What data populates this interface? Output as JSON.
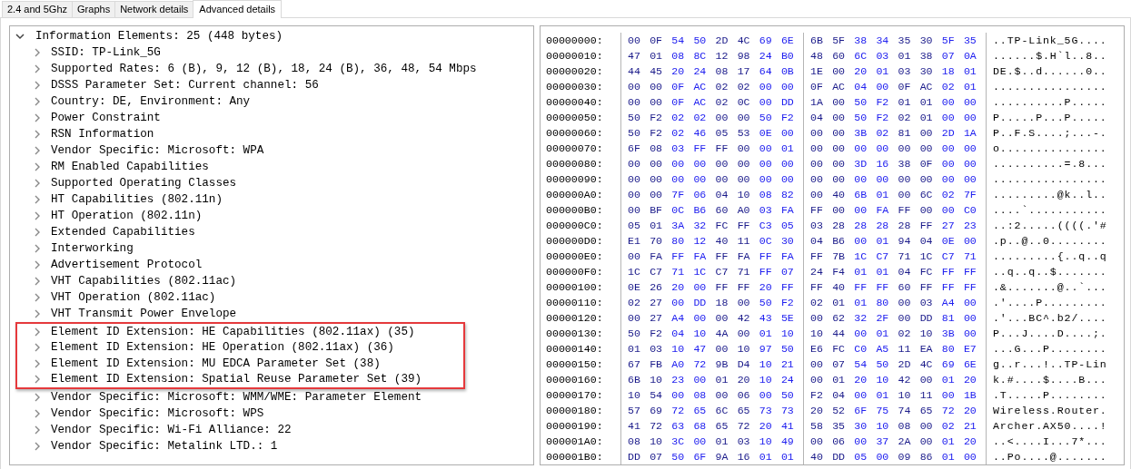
{
  "tabs": [
    {
      "label": "2.4 and 5Ghz",
      "selected": false
    },
    {
      "label": "Graphs",
      "selected": false
    },
    {
      "label": "Network details",
      "selected": false
    },
    {
      "label": "Advanced details",
      "selected": true
    }
  ],
  "tree": {
    "label": "Information Elements: 25 (448 bytes)",
    "expanded": true,
    "children": [
      {
        "label": "SSID: TP-Link_5G",
        "highlighted": false
      },
      {
        "label": "Supported Rates: 6 (B), 9, 12 (B), 18, 24 (B), 36, 48, 54 Mbps",
        "highlighted": false
      },
      {
        "label": "DSSS Parameter Set: Current channel: 56",
        "highlighted": false
      },
      {
        "label": "Country: DE, Environment: Any",
        "highlighted": false
      },
      {
        "label": "Power Constraint",
        "highlighted": false
      },
      {
        "label": "RSN Information",
        "highlighted": false
      },
      {
        "label": "Vendor Specific: Microsoft: WPA",
        "highlighted": false
      },
      {
        "label": "RM Enabled Capabilities",
        "highlighted": false
      },
      {
        "label": "Supported Operating Classes",
        "highlighted": false
      },
      {
        "label": "HT Capabilities (802.11n)",
        "highlighted": false
      },
      {
        "label": "HT Operation (802.11n)",
        "highlighted": false
      },
      {
        "label": "Extended Capabilities",
        "highlighted": false
      },
      {
        "label": "Interworking",
        "highlighted": false
      },
      {
        "label": "Advertisement Protocol",
        "highlighted": false
      },
      {
        "label": "VHT Capabilities (802.11ac)",
        "highlighted": false
      },
      {
        "label": "VHT Operation (802.11ac)",
        "highlighted": false
      },
      {
        "label": "VHT Transmit Power Envelope",
        "highlighted": false
      },
      {
        "label": "Element ID Extension: HE Capabilities (802.11ax) (35)",
        "highlighted": true
      },
      {
        "label": "Element ID Extension: HE Operation (802.11ax) (36)",
        "highlighted": true
      },
      {
        "label": "Element ID Extension: MU EDCA Parameter Set (38)",
        "highlighted": true
      },
      {
        "label": "Element ID Extension: Spatial Reuse Parameter Set (39)",
        "highlighted": true
      },
      {
        "label": "Vendor Specific: Microsoft: WMM/WME: Parameter Element",
        "highlighted": false
      },
      {
        "label": "Vendor Specific: Microsoft: WPS",
        "highlighted": false
      },
      {
        "label": "Vendor Specific: Wi-Fi Alliance: 22",
        "highlighted": false
      },
      {
        "label": "Vendor Specific: Metalink LTD.: 1",
        "highlighted": false
      }
    ]
  },
  "hex_rows": [
    {
      "offset": "00000000:",
      "bytes_1": "00 0F 54 50 2D 4C 69 6E",
      "bytes_2": "6B 5F 38 34 35 30 5F 35",
      "ascii": "..TP-Link_5G...."
    },
    {
      "offset": "00000010:",
      "bytes_1": "47 01 08 8C 12 98 24 B0",
      "bytes_2": "48 60 6C 03 01 38 07 0A",
      "ascii": "......$.H`l..8.."
    },
    {
      "offset": "00000020:",
      "bytes_1": "44 45 20 24 08 17 64 0B",
      "bytes_2": "1E 00 20 01 03 30 18 01",
      "ascii": "DE.$..d......0.."
    },
    {
      "offset": "00000030:",
      "bytes_1": "00 00 0F AC 02 02 00 00",
      "bytes_2": "0F AC 04 00 0F AC 02 01",
      "ascii": "................"
    },
    {
      "offset": "00000040:",
      "bytes_1": "00 00 0F AC 02 0C 00 DD",
      "bytes_2": "1A 00 50 F2 01 01 00 00",
      "ascii": "..........P....."
    },
    {
      "offset": "00000050:",
      "bytes_1": "50 F2 02 02 00 00 50 F2",
      "bytes_2": "04 00 50 F2 02 01 00 00",
      "ascii": "P.....P...P....."
    },
    {
      "offset": "00000060:",
      "bytes_1": "50 F2 02 46 05 53 0E 00",
      "bytes_2": "00 00 3B 02 81 00 2D 1A",
      "ascii": "P..F.S....;...-."
    },
    {
      "offset": "00000070:",
      "bytes_1": "6F 08 03 FF FF 00 00 01",
      "bytes_2": "00 00 00 00 00 00 00 00",
      "ascii": "o..............."
    },
    {
      "offset": "00000080:",
      "bytes_1": "00 00 00 00 00 00 00 00",
      "bytes_2": "00 00 3D 16 38 0F 00 00",
      "ascii": "..........=.8..."
    },
    {
      "offset": "00000090:",
      "bytes_1": "00 00 00 00 00 00 00 00",
      "bytes_2": "00 00 00 00 00 00 00 00",
      "ascii": "................"
    },
    {
      "offset": "000000A0:",
      "bytes_1": "00 00 7F 06 04 10 08 82",
      "bytes_2": "00 40 6B 01 00 6C 02 7F",
      "ascii": ".........@k..l.."
    },
    {
      "offset": "000000B0:",
      "bytes_1": "00 BF 0C B6 60 A0 03 FA",
      "bytes_2": "FF 00 00 FA FF 00 00 C0",
      "ascii": "....`..........."
    },
    {
      "offset": "000000C0:",
      "bytes_1": "05 01 3A 32 FC FF C3 05",
      "bytes_2": "03 28 28 28 28 FF 27 23",
      "ascii": "..:2.....((((.'#"
    },
    {
      "offset": "000000D0:",
      "bytes_1": "E1 70 80 12 40 11 0C 30",
      "bytes_2": "04 B6 00 01 94 04 0E 00",
      "ascii": ".p..@..0........"
    },
    {
      "offset": "000000E0:",
      "bytes_1": "00 FA FF FA FF FA FF FA",
      "bytes_2": "FF 7B 1C C7 71 1C C7 71",
      "ascii": ".........{..q..q"
    },
    {
      "offset": "000000F0:",
      "bytes_1": "1C C7 71 1C C7 71 FF 07",
      "bytes_2": "24 F4 01 01 04 FC FF FF",
      "ascii": "..q..q..$......."
    },
    {
      "offset": "00000100:",
      "bytes_1": "0E 26 20 00 FF FF 20 FF",
      "bytes_2": "FF 40 FF FF 60 FF FF FF",
      "ascii": ".&.......@..`..."
    },
    {
      "offset": "00000110:",
      "bytes_1": "02 27 00 DD 18 00 50 F2",
      "bytes_2": "02 01 01 80 00 03 A4 00",
      "ascii": ".'....P........."
    },
    {
      "offset": "00000120:",
      "bytes_1": "00 27 A4 00 00 42 43 5E",
      "bytes_2": "00 62 32 2F 00 DD 81 00",
      "ascii": ".'...BC^.b2/...."
    },
    {
      "offset": "00000130:",
      "bytes_1": "50 F2 04 10 4A 00 01 10",
      "bytes_2": "10 44 00 01 02 10 3B 00",
      "ascii": "P...J....D....;."
    },
    {
      "offset": "00000140:",
      "bytes_1": "01 03 10 47 00 10 97 50",
      "bytes_2": "E6 FC C0 A5 11 EA 80 E7",
      "ascii": "...G...P........"
    },
    {
      "offset": "00000150:",
      "bytes_1": "67 FB A0 72 9B D4 10 21",
      "bytes_2": "00 07 54 50 2D 4C 69 6E",
      "ascii": "g..r...!..TP-Lin"
    },
    {
      "offset": "00000160:",
      "bytes_1": "6B 10 23 00 01 20 10 24",
      "bytes_2": "00 01 20 10 42 00 01 20",
      "ascii": "k.#....$....B..."
    },
    {
      "offset": "00000170:",
      "bytes_1": "10 54 00 08 00 06 00 50",
      "bytes_2": "F2 04 00 01 10 11 00 1B",
      "ascii": ".T.....P........"
    },
    {
      "offset": "00000180:",
      "bytes_1": "57 69 72 65 6C 65 73 73",
      "bytes_2": "20 52 6F 75 74 65 72 20",
      "ascii": "Wireless.Router."
    },
    {
      "offset": "00000190:",
      "bytes_1": "41 72 63 68 65 72 20 41",
      "bytes_2": "58 35 30 10 08 00 02 21",
      "ascii": "Archer.AX50....!"
    },
    {
      "offset": "000001A0:",
      "bytes_1": "08 10 3C 00 01 03 10 49",
      "bytes_2": "00 06 00 37 2A 00 01 20",
      "ascii": "..<....I...7*..."
    },
    {
      "offset": "000001B0:",
      "bytes_1": "DD 07 50 6F 9A 16 01 01",
      "bytes_2": "40 DD 05 00 09 86 01 00",
      "ascii": "..Po....@......."
    }
  ]
}
